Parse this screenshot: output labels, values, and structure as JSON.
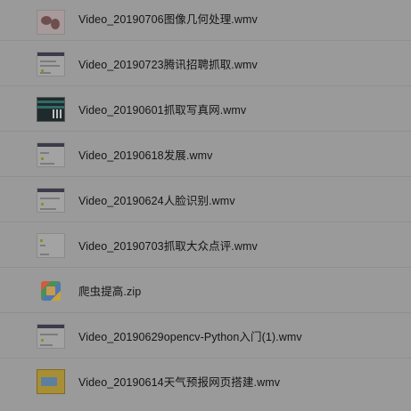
{
  "files": [
    {
      "name": "Video_20190706图像几何处理.wmv",
      "icon": "video-thumbnail-icon"
    },
    {
      "name": "Video_20190723腾讯招聘抓取.wmv",
      "icon": "video-thumbnail-icon"
    },
    {
      "name": "Video_20190601抓取写真网.wmv",
      "icon": "video-thumbnail-icon"
    },
    {
      "name": "Video_20190618发展.wmv",
      "icon": "video-thumbnail-icon"
    },
    {
      "name": "Video_20190624人脸识别.wmv",
      "icon": "video-thumbnail-icon"
    },
    {
      "name": "Video_20190703抓取大众点评.wmv",
      "icon": "video-thumbnail-icon"
    },
    {
      "name": "爬虫提高.zip",
      "icon": "zip-archive-icon"
    },
    {
      "name": "Video_20190629opencv-Python入门(1).wmv",
      "icon": "video-thumbnail-icon"
    },
    {
      "name": "Video_20190614天气预报网页搭建.wmv",
      "icon": "video-thumbnail-icon"
    }
  ]
}
